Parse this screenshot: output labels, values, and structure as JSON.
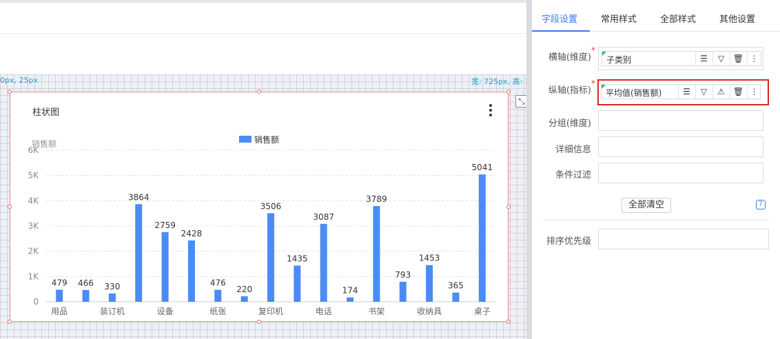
{
  "canvas": {
    "pos_label": "0px, 25px",
    "size_label": "宽: 725px, 高: 3",
    "expand_icon": "expand-icon"
  },
  "chart_card": {
    "title": "柱状图",
    "menu_icon": "more-vertical-icon"
  },
  "chart_data": {
    "type": "bar",
    "categories": [
      "用品",
      "装订机",
      "设备",
      "纸张",
      "复印机",
      "电话",
      "书架",
      "收纳具",
      "桌子"
    ],
    "bar_values": [
      479,
      466,
      330,
      3864,
      2759,
      2428,
      476,
      220,
      3506,
      1435,
      3087,
      174,
      3789,
      793,
      1453,
      365,
      5041
    ],
    "x_tick_labels": [
      "用品",
      "装订机",
      "设备",
      "纸张",
      "复印机",
      "电话",
      "书架",
      "收纳具",
      "桌子"
    ],
    "series": [
      {
        "name": "销售额",
        "values": [
          479,
          466,
          330,
          3864,
          2759,
          2428,
          476,
          220,
          3506,
          1435,
          3087,
          174,
          3789,
          793,
          1453,
          365,
          5041
        ]
      }
    ],
    "ylabel": "销售额",
    "ylim": [
      0,
      6000
    ],
    "y_ticks": [
      "0",
      "1K",
      "2K",
      "3K",
      "4K",
      "5K",
      "6K"
    ],
    "legend_position": "top-center",
    "grid": true,
    "bar_color": "#4b8bf5"
  },
  "panel": {
    "tabs": [
      {
        "label": "字段设置",
        "active": true
      },
      {
        "label": "常用样式",
        "active": false
      },
      {
        "label": "全部样式",
        "active": false
      },
      {
        "label": "其他设置",
        "active": false
      }
    ],
    "fields": {
      "x_axis": {
        "label": "横轴(维度)",
        "required": "*",
        "value": "子类别"
      },
      "y_axis": {
        "label": "纵轴(指标)",
        "required": "*",
        "value": "平均值(销售额)"
      },
      "group": {
        "label": "分组(维度)"
      },
      "detail": {
        "label": "详细信息"
      },
      "filter": {
        "label": "条件过滤"
      },
      "sort": {
        "label": "排序优先级"
      }
    },
    "clear_all": "全部清空",
    "help": "?",
    "icons": {
      "sort": "sort-icon",
      "filter": "filter-icon",
      "warning": "warning-icon",
      "delete": "trash-icon",
      "more": "more-icon"
    },
    "accent_color": "#3a79f0",
    "highlight_color": "#d9251d"
  }
}
